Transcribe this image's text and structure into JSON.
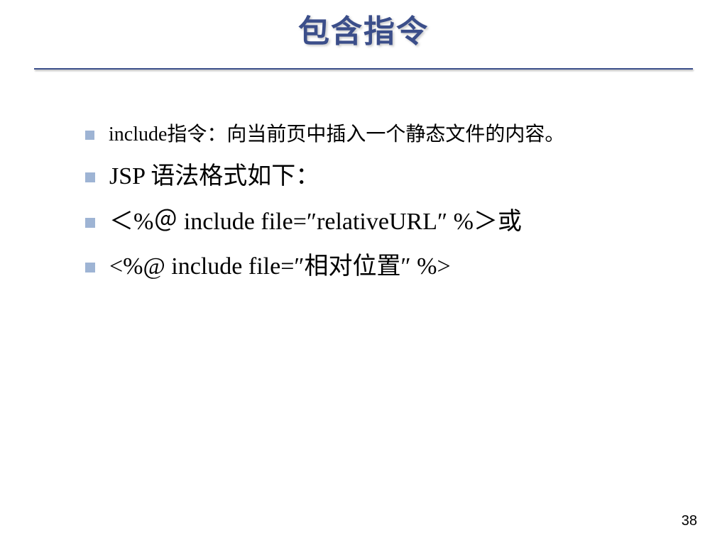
{
  "title": "包含指令",
  "bullets": [
    {
      "size": "small",
      "text": "include指令：向当前页中插入一个静态文件的内容。"
    },
    {
      "size": "large",
      "text": "JSP 语法格式如下："
    },
    {
      "size": "large",
      "text": "＜%＠ include file=″relativeURL″ %＞或"
    },
    {
      "size": "large",
      "text": "<%@ include file=″相对位置″ %>"
    }
  ],
  "pageNumber": "38"
}
